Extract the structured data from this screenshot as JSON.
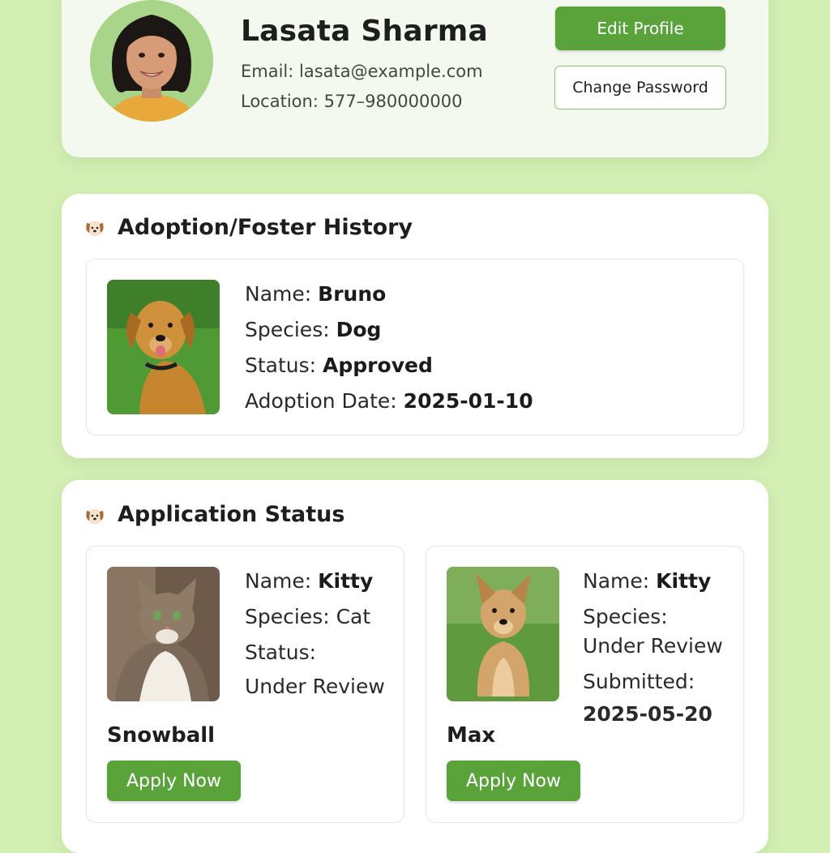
{
  "profile": {
    "name": "Lasata Sharma",
    "email_label": "Email:",
    "email": "lasata@example.com",
    "location_label": "Location:",
    "location": "577–980000000",
    "edit_label": "Edit Profile",
    "password_label": "Change Password"
  },
  "history": {
    "title": "Adoption/Foster History",
    "icon": "dog-face-icon",
    "pet": {
      "name_label": "Name:",
      "name": "Bruno",
      "species_label": "Species:",
      "species": "Dog",
      "status_label": "Status:",
      "status": "Approved",
      "date_label": "Adoption Date:",
      "date": "2025-01-10"
    }
  },
  "applications": {
    "title": "Application Status",
    "icon": "dog-face-icon",
    "items": [
      {
        "name_label": "Name:",
        "name": "Kitty",
        "species_label": "Species:",
        "species": "Cat",
        "status_label": "Status:",
        "status": "Under Review",
        "title": "Snowball",
        "button": "Apply Now"
      },
      {
        "name_label": "Name:",
        "name": "Kitty",
        "species_label": "Species:",
        "species_value": "Under Review",
        "submitted_label": "Submitted:",
        "submitted": "2025-05-20",
        "title": "Max",
        "button": "Apply Now"
      }
    ]
  },
  "colors": {
    "background": "#d3efb4",
    "accent": "#5aa33b",
    "outline": "#8cc26f"
  }
}
